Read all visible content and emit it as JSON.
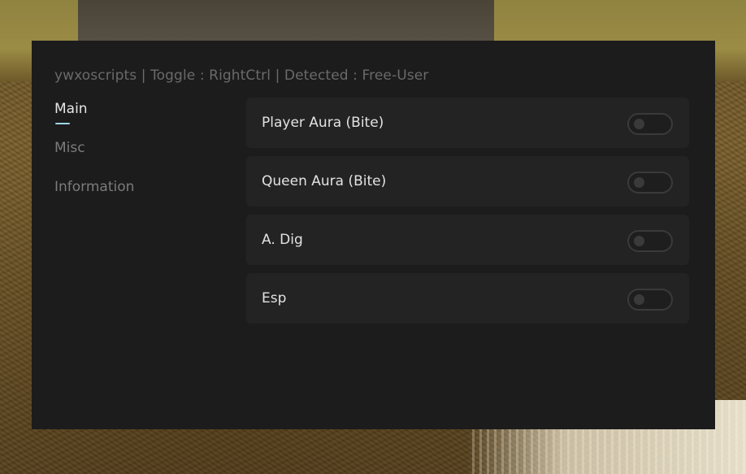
{
  "header": {
    "title": "ywxoscripts  |  Toggle : RightCtrl  |  Detected : Free-User"
  },
  "tabs": [
    {
      "label": "Main",
      "active": true
    },
    {
      "label": "Misc",
      "active": false
    },
    {
      "label": "Information",
      "active": false
    }
  ],
  "features": [
    {
      "label": "Player Aura (Bite)",
      "enabled": false
    },
    {
      "label": "Queen Aura (Bite)",
      "enabled": false
    },
    {
      "label": "A. Dig",
      "enabled": false
    },
    {
      "label": "Esp",
      "enabled": false
    }
  ],
  "colors": {
    "accent": "#9fd3ea",
    "panel": "#1c1c1c",
    "row": "#232323"
  }
}
